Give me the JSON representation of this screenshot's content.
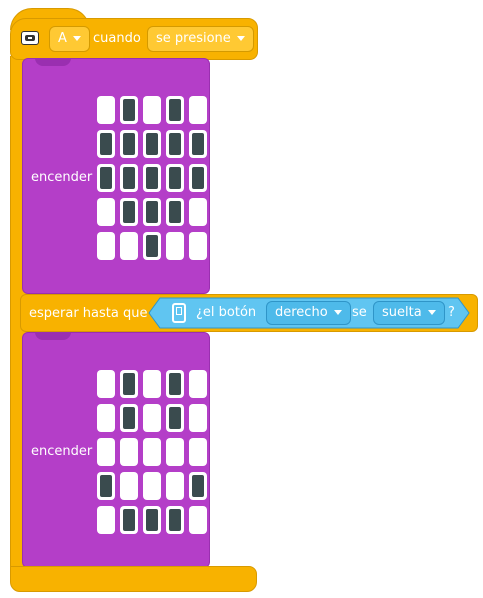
{
  "event_block": {
    "button_selected": "A",
    "when_label": "cuando",
    "action_selected": "se presione"
  },
  "first_light_block": {
    "label": "encender",
    "grid": [
      [
        0,
        1,
        0,
        1,
        0
      ],
      [
        1,
        1,
        1,
        1,
        1
      ],
      [
        1,
        1,
        1,
        1,
        1
      ],
      [
        0,
        1,
        1,
        1,
        0
      ],
      [
        0,
        0,
        1,
        0,
        0
      ]
    ]
  },
  "wait_block": {
    "label": "esperar hasta que",
    "condition": {
      "prefix": "¿el botón",
      "button_selected": "derecho",
      "middle": "se",
      "state_selected": "suelta",
      "suffix": "?"
    }
  },
  "second_light_block": {
    "label": "encender",
    "grid": [
      [
        0,
        1,
        0,
        1,
        0
      ],
      [
        0,
        1,
        0,
        1,
        0
      ],
      [
        0,
        0,
        0,
        0,
        0
      ],
      [
        1,
        0,
        0,
        0,
        1
      ],
      [
        0,
        1,
        1,
        1,
        0
      ]
    ]
  },
  "icons": [
    "hub-icon",
    "sensor-hub-icon",
    "chevron-down-icon"
  ],
  "colors": {
    "event": "#f8b200",
    "light": "#b43ec8",
    "sensor": "#4ebaea",
    "led_on": "#3a4b4e"
  }
}
